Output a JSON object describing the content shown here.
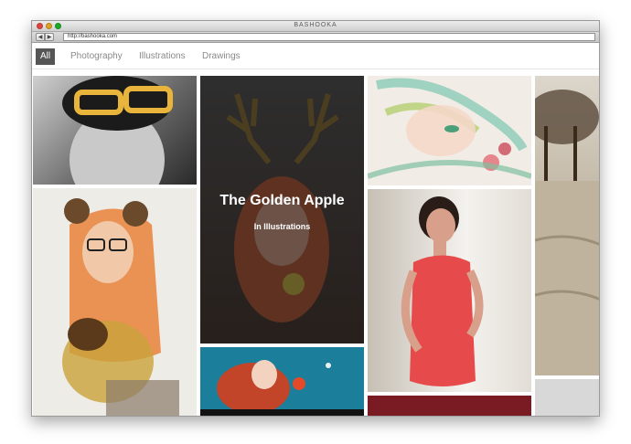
{
  "window": {
    "title": "BASHOOKA"
  },
  "browser": {
    "url": "http://bashooka.com",
    "back_label": "◀",
    "forward_label": "▶"
  },
  "filters": [
    {
      "label": "All",
      "active": true
    },
    {
      "label": "Photography",
      "active": false
    },
    {
      "label": "Illustrations",
      "active": false
    },
    {
      "label": "Drawings",
      "active": false
    }
  ],
  "featured": {
    "title": "The Golden Apple",
    "category": "In Illustrations"
  },
  "colors": {
    "active_filter_bg": "#555555",
    "filter_text": "#8a8a8a",
    "overlay": "rgba(24,24,24,0.55)"
  }
}
